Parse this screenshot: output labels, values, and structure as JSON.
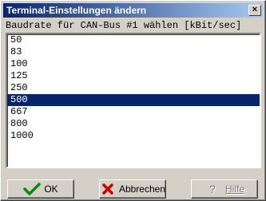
{
  "window": {
    "title": "Terminal-Einstellungen ändern",
    "close_glyph": "×"
  },
  "prompt": "Baudrate für CAN-Bus #1 wählen [kBit/sec]",
  "list": {
    "items": [
      "50",
      "83",
      "100",
      "125",
      "250",
      "500",
      "667",
      "800",
      "1000"
    ],
    "selected": "500"
  },
  "buttons": {
    "ok": {
      "label": "OK",
      "icon": "green-check-icon"
    },
    "cancel": {
      "label": "Abbrechen",
      "icon": "red-x-icon"
    },
    "help": {
      "label": "Hilfe",
      "icon": "question-mark-icon",
      "enabled": false
    }
  },
  "colors": {
    "title_start": "#0a246a",
    "title_end": "#a6caf0",
    "selection": "#0a246a",
    "face": "#d4d0c8"
  }
}
